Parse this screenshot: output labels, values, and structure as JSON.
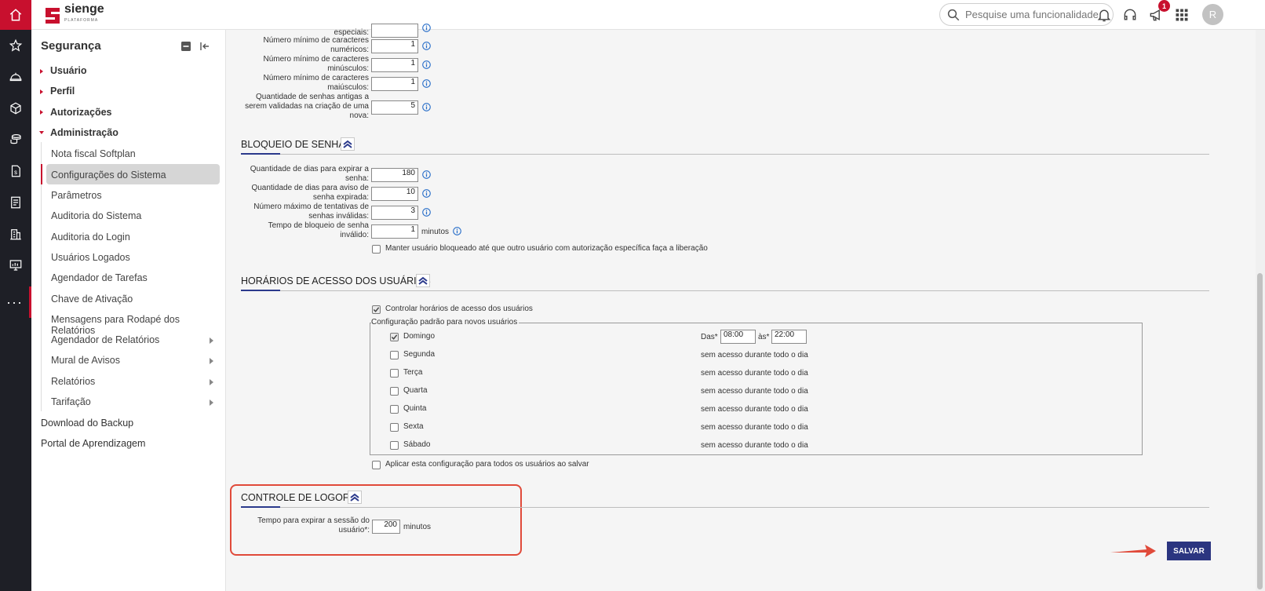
{
  "app": {
    "logo_text": "sienge",
    "logo_sub": "PLATAFORMA",
    "search_placeholder": "Pesquise uma funcionalidade.",
    "notification_count": "1",
    "avatar_initial": "R"
  },
  "rail": {
    "icons": [
      "home-icon",
      "star-icon",
      "helmet-icon",
      "cube-icon",
      "coins-icon",
      "document-money-icon",
      "receipt-icon",
      "building-icon",
      "monitor-icon"
    ],
    "more_label": "···"
  },
  "sidebar": {
    "title": "Segurança",
    "parents": [
      "Usuário",
      "Perfil",
      "Autorizações",
      "Administração"
    ],
    "children": [
      "Nota fiscal Softplan",
      "Configurações do Sistema",
      "Parâmetros",
      "Auditoria do Sistema",
      "Auditoria do Login",
      "Usuários Logados",
      "Agendador de Tarefas",
      "Chave de Ativação",
      "Mensagens para Rodapé dos Relatórios",
      "Agendador de Relatórios",
      "Mural de Avisos",
      "Relatórios",
      "Tarifação"
    ],
    "roots": [
      "Download do Backup",
      "Portal de Aprendizagem"
    ]
  },
  "password_rules": {
    "special_label_tail": "especiais:",
    "numeric_label_1": "Número mínimo de caracteres",
    "numeric_label_2": "numéricos:",
    "numeric_value": "1",
    "lower_label_1": "Número mínimo de caracteres",
    "lower_label_2": "minúsculos:",
    "lower_value": "1",
    "upper_label_1": "Número mínimo de caracteres",
    "upper_label_2": "maiúsculos:",
    "upper_value": "1",
    "history_label_1": "Quantidade de senhas antigas a",
    "history_label_2": "serem validadas na criação de uma",
    "history_label_3": "nova:",
    "history_value": "5"
  },
  "block": {
    "title": "BLOQUEIO DE SENHA",
    "expire_label_1": "Quantidade de dias para expirar a",
    "expire_label_2": "senha:",
    "expire_value": "180",
    "warn_label_1": "Quantidade de dias para aviso de",
    "warn_label_2": "senha expirada:",
    "warn_value": "10",
    "attempts_label_1": "Número máximo de tentativas de",
    "attempts_label_2": "senhas inválidas:",
    "attempts_value": "3",
    "lock_label_1": "Tempo de bloqueio de senha",
    "lock_label_2": "inválido:",
    "lock_value": "1",
    "lock_unit": "minutos",
    "keep_blocked_label": "Manter usuário bloqueado até que outro usuário com autorização específica faça a liberação"
  },
  "access": {
    "title": "HORÁRIOS DE ACESSO DOS USUÁRIOS",
    "control_label": "Controlar horários de acesso dos usuários",
    "legend": "Configuração padrão para novos usuários",
    "from_label": "Das*",
    "to_label": "às*",
    "from_value": "08:00",
    "to_value": "22:00",
    "no_access": "sem acesso durante todo o dia",
    "days": [
      "Domingo",
      "Segunda",
      "Terça",
      "Quarta",
      "Quinta",
      "Sexta",
      "Sábado"
    ],
    "apply_all_label": "Aplicar esta configuração para todos os usuários ao salvar"
  },
  "logoff": {
    "title": "CONTROLE DE LOGOFF",
    "session_label_1": "Tempo para expirar a sessão do",
    "session_label_2": "usuário*:",
    "session_value": "200",
    "session_unit": "minutos"
  },
  "actions": {
    "save_label": "SALVAR"
  },
  "colors": {
    "brand_red": "#c8102e",
    "rail_dark": "#1e1f26",
    "accent_blue": "#2b3a8c",
    "highlight_red": "#e04a3a"
  }
}
